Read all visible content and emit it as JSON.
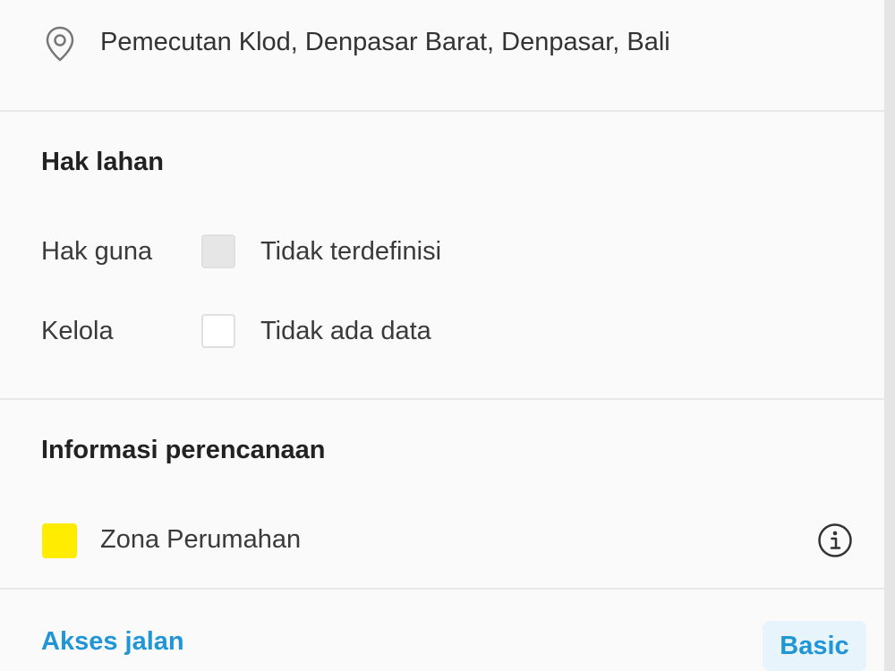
{
  "location": {
    "icon": "map-pin-icon",
    "address": "Pemecutan Klod, Denpasar Barat, Denpasar, Bali"
  },
  "land_rights": {
    "title": "Hak lahan",
    "rows": [
      {
        "label": "Hak guna",
        "value": "Tidak terdefinisi",
        "swatch_color": "#e6e6e6"
      },
      {
        "label": "Kelola",
        "value": "Tidak ada data",
        "swatch_color": "#ffffff"
      }
    ]
  },
  "planning": {
    "title": "Informasi perencanaan",
    "zone": {
      "label": "Zona Perumahan",
      "swatch_color": "#ffec00",
      "info_icon": "info-circle-icon"
    }
  },
  "footer": {
    "link": "Akses jalan",
    "chip": "Basic",
    "link_color": "#2196d6",
    "chip_background": "#e8f4fb"
  }
}
